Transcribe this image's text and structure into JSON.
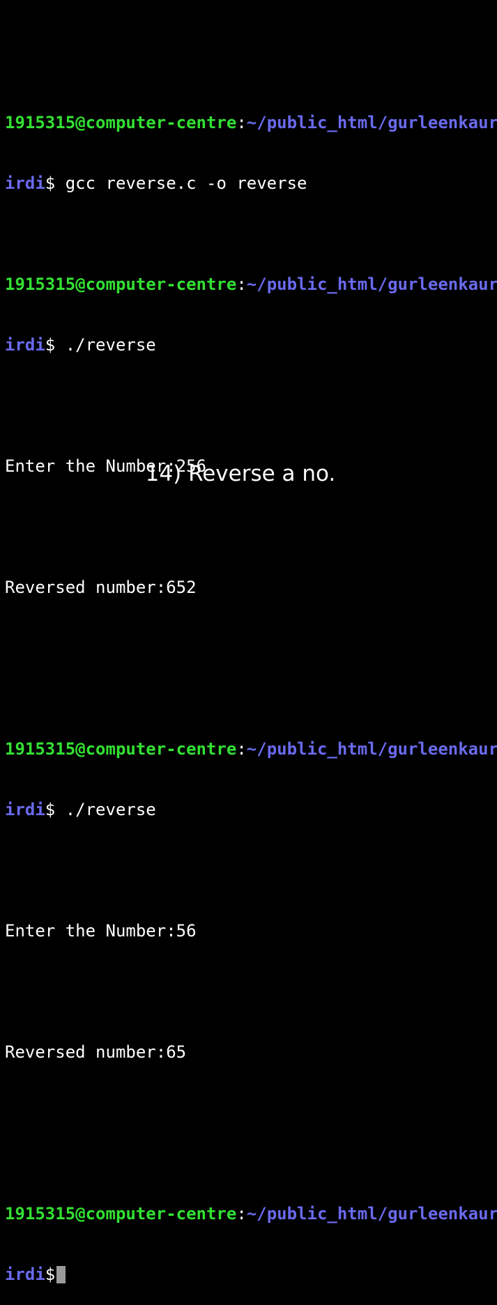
{
  "prompt": {
    "user_host": "1915315@computer-centre",
    "colon": ":",
    "path_part1": "~/public_html/gurleenkaurb",
    "path_part2": "irdi",
    "dollar": "$"
  },
  "commands": {
    "compile": " gcc reverse.c -o reverse",
    "run1": " ./reverse",
    "run2": " ./reverse"
  },
  "output": {
    "enter1": "Enter the Number:256",
    "result1": "Reversed number:652",
    "enter2": "Enter the Number:56",
    "result2": "Reversed number:65"
  },
  "caption": "14) Reverse a no.",
  "colors": {
    "user_host": "#33e033",
    "path": "#6a6aee",
    "text": "#ffffff",
    "background": "#000000",
    "cursor": "#9a9a9a"
  }
}
